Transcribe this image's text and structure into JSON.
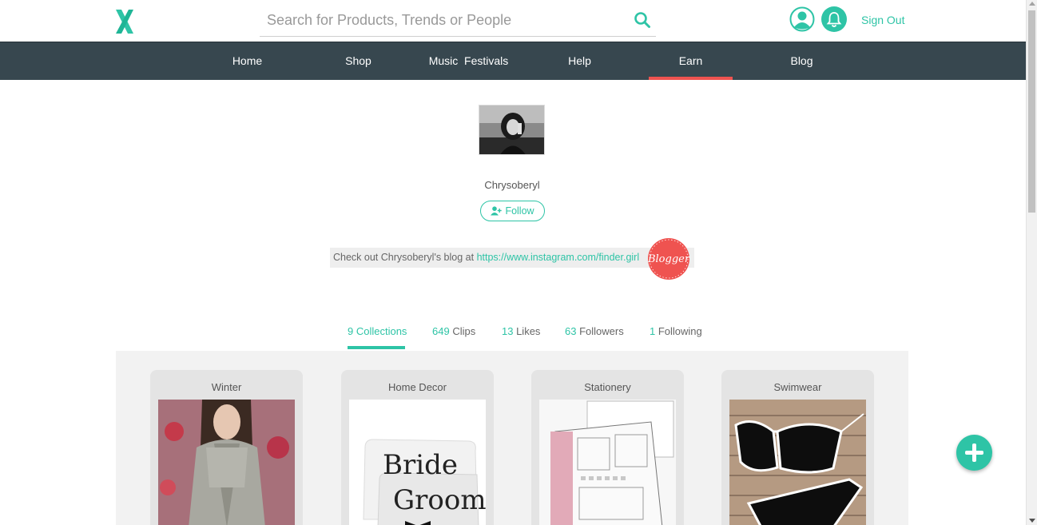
{
  "header": {
    "search_placeholder": "Search for Products, Trends or People",
    "sign_out": "Sign Out",
    "accent_color": "#2ec4a6"
  },
  "nav": {
    "items": [
      {
        "label": "Home"
      },
      {
        "label": "Shop"
      },
      {
        "label": "Music  Festivals"
      },
      {
        "label": "Help"
      },
      {
        "label": "Earn",
        "active": true
      },
      {
        "label": "Blog"
      }
    ],
    "background": "#37474f",
    "active_indicator": "#ef5350"
  },
  "profile": {
    "name": "Chrysoberyl",
    "follow_label": "Follow",
    "blog_prefix": "Check out Chrysoberyl's blog at ",
    "blog_url": "https://www.instagram.com/finder.girl",
    "badge_label": "Blogger",
    "badge_color": "#ef5350"
  },
  "tabs": [
    {
      "count": "9",
      "label": " Collections",
      "active": true
    },
    {
      "count": "649",
      "label": " Clips"
    },
    {
      "count": "13",
      "label": " Likes"
    },
    {
      "count": "63",
      "label": " Followers"
    },
    {
      "count": "1",
      "label": " Following"
    }
  ],
  "collections": [
    {
      "title": "Winter"
    },
    {
      "title": "Home Decor",
      "image_text_1": "Bride",
      "image_text_2": "Groom"
    },
    {
      "title": "Stationery"
    },
    {
      "title": "Swimwear"
    }
  ],
  "icons": {
    "logo": "x-logo-icon",
    "search": "search-icon",
    "user": "user-icon",
    "bell": "bell-icon",
    "follow": "add-user-icon",
    "fab": "plus-icon"
  }
}
